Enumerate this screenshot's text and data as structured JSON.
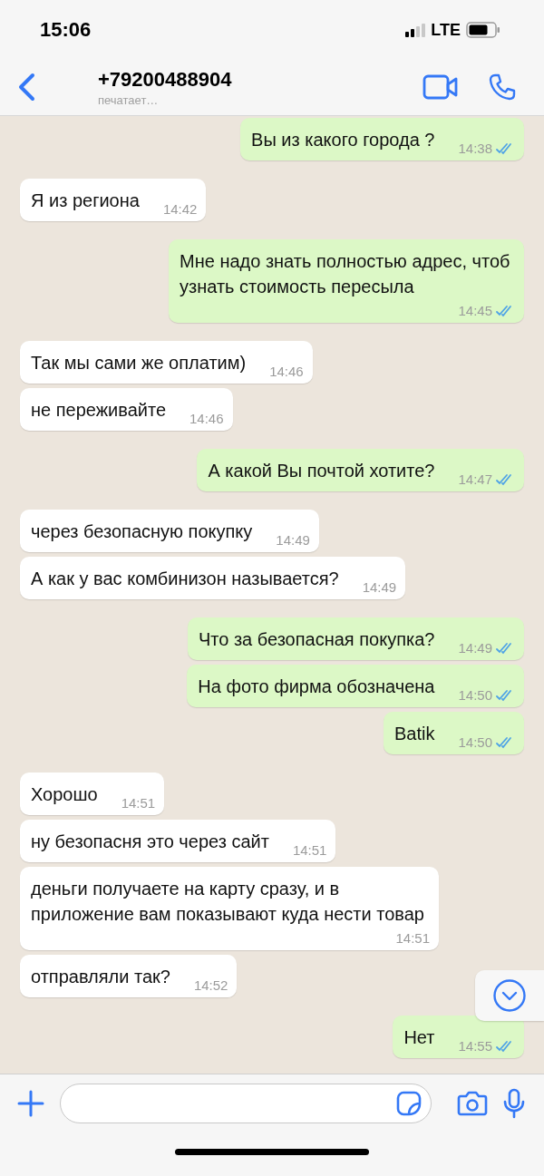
{
  "status_bar": {
    "time": "15:06",
    "network": "LTE"
  },
  "header": {
    "contact": "+79200488904",
    "status": "печатает…"
  },
  "messages": [
    {
      "kind": "out",
      "text": "Вы из какого города ?",
      "time": "14:38",
      "read": true
    },
    {
      "kind": "in",
      "text": "Я из региона",
      "time": "14:42"
    },
    {
      "kind": "out",
      "text": "Мне надо знать полностью адрес, чтоб узнать стоимость пересыла",
      "time": "14:45",
      "read": true
    },
    {
      "kind": "in",
      "text": "Так мы сами же оплатим)",
      "time": "14:46"
    },
    {
      "kind": "in",
      "text": "не переживайте",
      "time": "14:46"
    },
    {
      "kind": "out",
      "text": "А какой Вы почтой хотите?",
      "time": "14:47",
      "read": true
    },
    {
      "kind": "in",
      "text": "через безопасную покупку",
      "time": "14:49"
    },
    {
      "kind": "in",
      "text": "А как у вас комбинизон называется?",
      "time": "14:49"
    },
    {
      "kind": "out",
      "text": "Что за безопасная покупка?",
      "time": "14:49",
      "read": true
    },
    {
      "kind": "out",
      "text": "На фото фирма обозначена",
      "time": "14:50",
      "read": true
    },
    {
      "kind": "out",
      "text": "Batik",
      "time": "14:50",
      "read": true
    },
    {
      "kind": "in",
      "text": "Хорошо",
      "time": "14:51"
    },
    {
      "kind": "in",
      "text": "ну безопасня это через сайт",
      "time": "14:51"
    },
    {
      "kind": "in",
      "text": "деньги получаете на карту сразу, и в приложение вам показывают куда нести товар",
      "time": "14:51"
    },
    {
      "kind": "in",
      "text": "отправляли так?",
      "time": "14:52"
    },
    {
      "kind": "out",
      "text": "Нет",
      "time": "14:55",
      "read": true
    }
  ]
}
